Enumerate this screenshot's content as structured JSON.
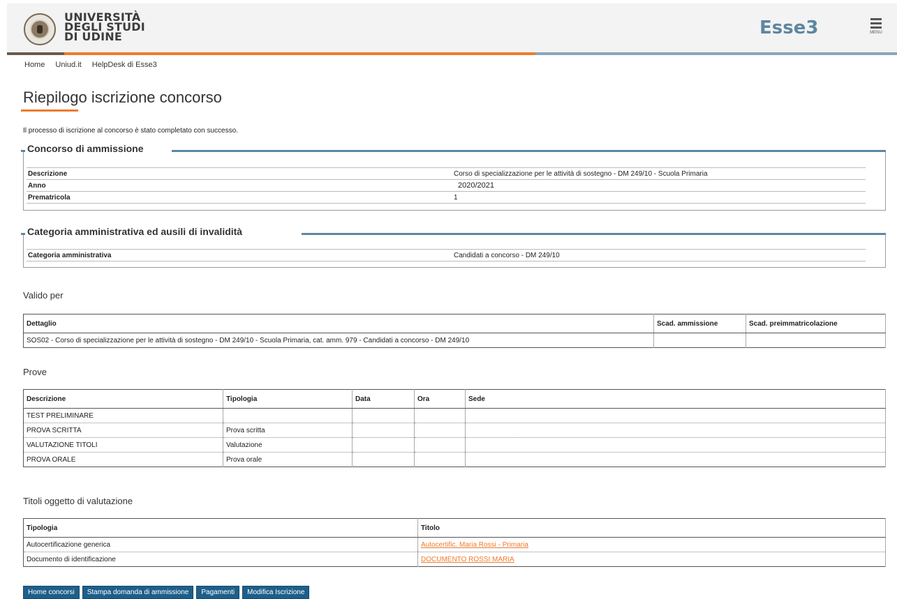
{
  "header": {
    "logo_lines": [
      "UNIVERSITÀ",
      "DEGLI STUDI",
      "DI UDINE"
    ],
    "app_name": "Esse3",
    "menu_label": "MENU"
  },
  "nav": [
    "Home",
    "Uniud.it",
    "HelpDesk di Esse3"
  ],
  "page": {
    "title": "Riepilogo iscrizione concorso",
    "success_message": "Il processo di iscrizione al concorso è stato completato con successo."
  },
  "concorso": {
    "heading": "Concorso di ammissione",
    "rows": [
      {
        "label": "Descrizione",
        "value": "Corso di specializzazione per le attività di sostegno - DM 249/10 - Scuola Primaria"
      },
      {
        "label": "Anno",
        "value": "2020/2021"
      },
      {
        "label": "Prematricola",
        "value": "1"
      }
    ]
  },
  "categoria": {
    "heading": "Categoria amministrativa ed ausili di invalidità",
    "rows": [
      {
        "label": "Categoria amministrativa",
        "value": "Candidati a concorso - DM 249/10"
      }
    ]
  },
  "valido_per": {
    "heading": "Valido per",
    "columns": [
      "Dettaglio",
      "Scad. ammissione",
      "Scad. preimmatricolazione"
    ],
    "rows": [
      [
        "SOS02 - Corso di specializzazione per le attività di sostegno - DM 249/10 - Scuola Primaria, cat. amm. 979 - Candidati a concorso - DM 249/10",
        "",
        ""
      ]
    ]
  },
  "prove": {
    "heading": "Prove",
    "columns": [
      "Descrizione",
      "Tipologia",
      "Data",
      "Ora",
      "Sede"
    ],
    "rows": [
      [
        "TEST PRELIMINARE",
        "",
        "",
        "",
        ""
      ],
      [
        "PROVA SCRITTA",
        "Prova scritta",
        "",
        "",
        ""
      ],
      [
        "VALUTAZIONE TITOLI",
        "Valutazione",
        "",
        "",
        ""
      ],
      [
        "PROVA ORALE",
        "Prova orale",
        "",
        "",
        ""
      ]
    ]
  },
  "titoli": {
    "heading": "Titoli oggetto di valutazione",
    "columns": [
      "Tipologia",
      "Titolo"
    ],
    "rows": [
      [
        "Autocertificazione generica",
        "Autocertific. Maria Rossi - Primaria"
      ],
      [
        "Documento di identificazione",
        "DOCUMENTO ROSSI MARIA"
      ]
    ]
  },
  "buttons": [
    "Home concorsi",
    "Stampa domanda di ammissione",
    "Pagamenti",
    "Modifica Iscrizione"
  ],
  "colors": {
    "accent_orange": "#ee7a2e",
    "accent_blue": "#5d87a1",
    "button_blue": "#1e5f8a"
  }
}
